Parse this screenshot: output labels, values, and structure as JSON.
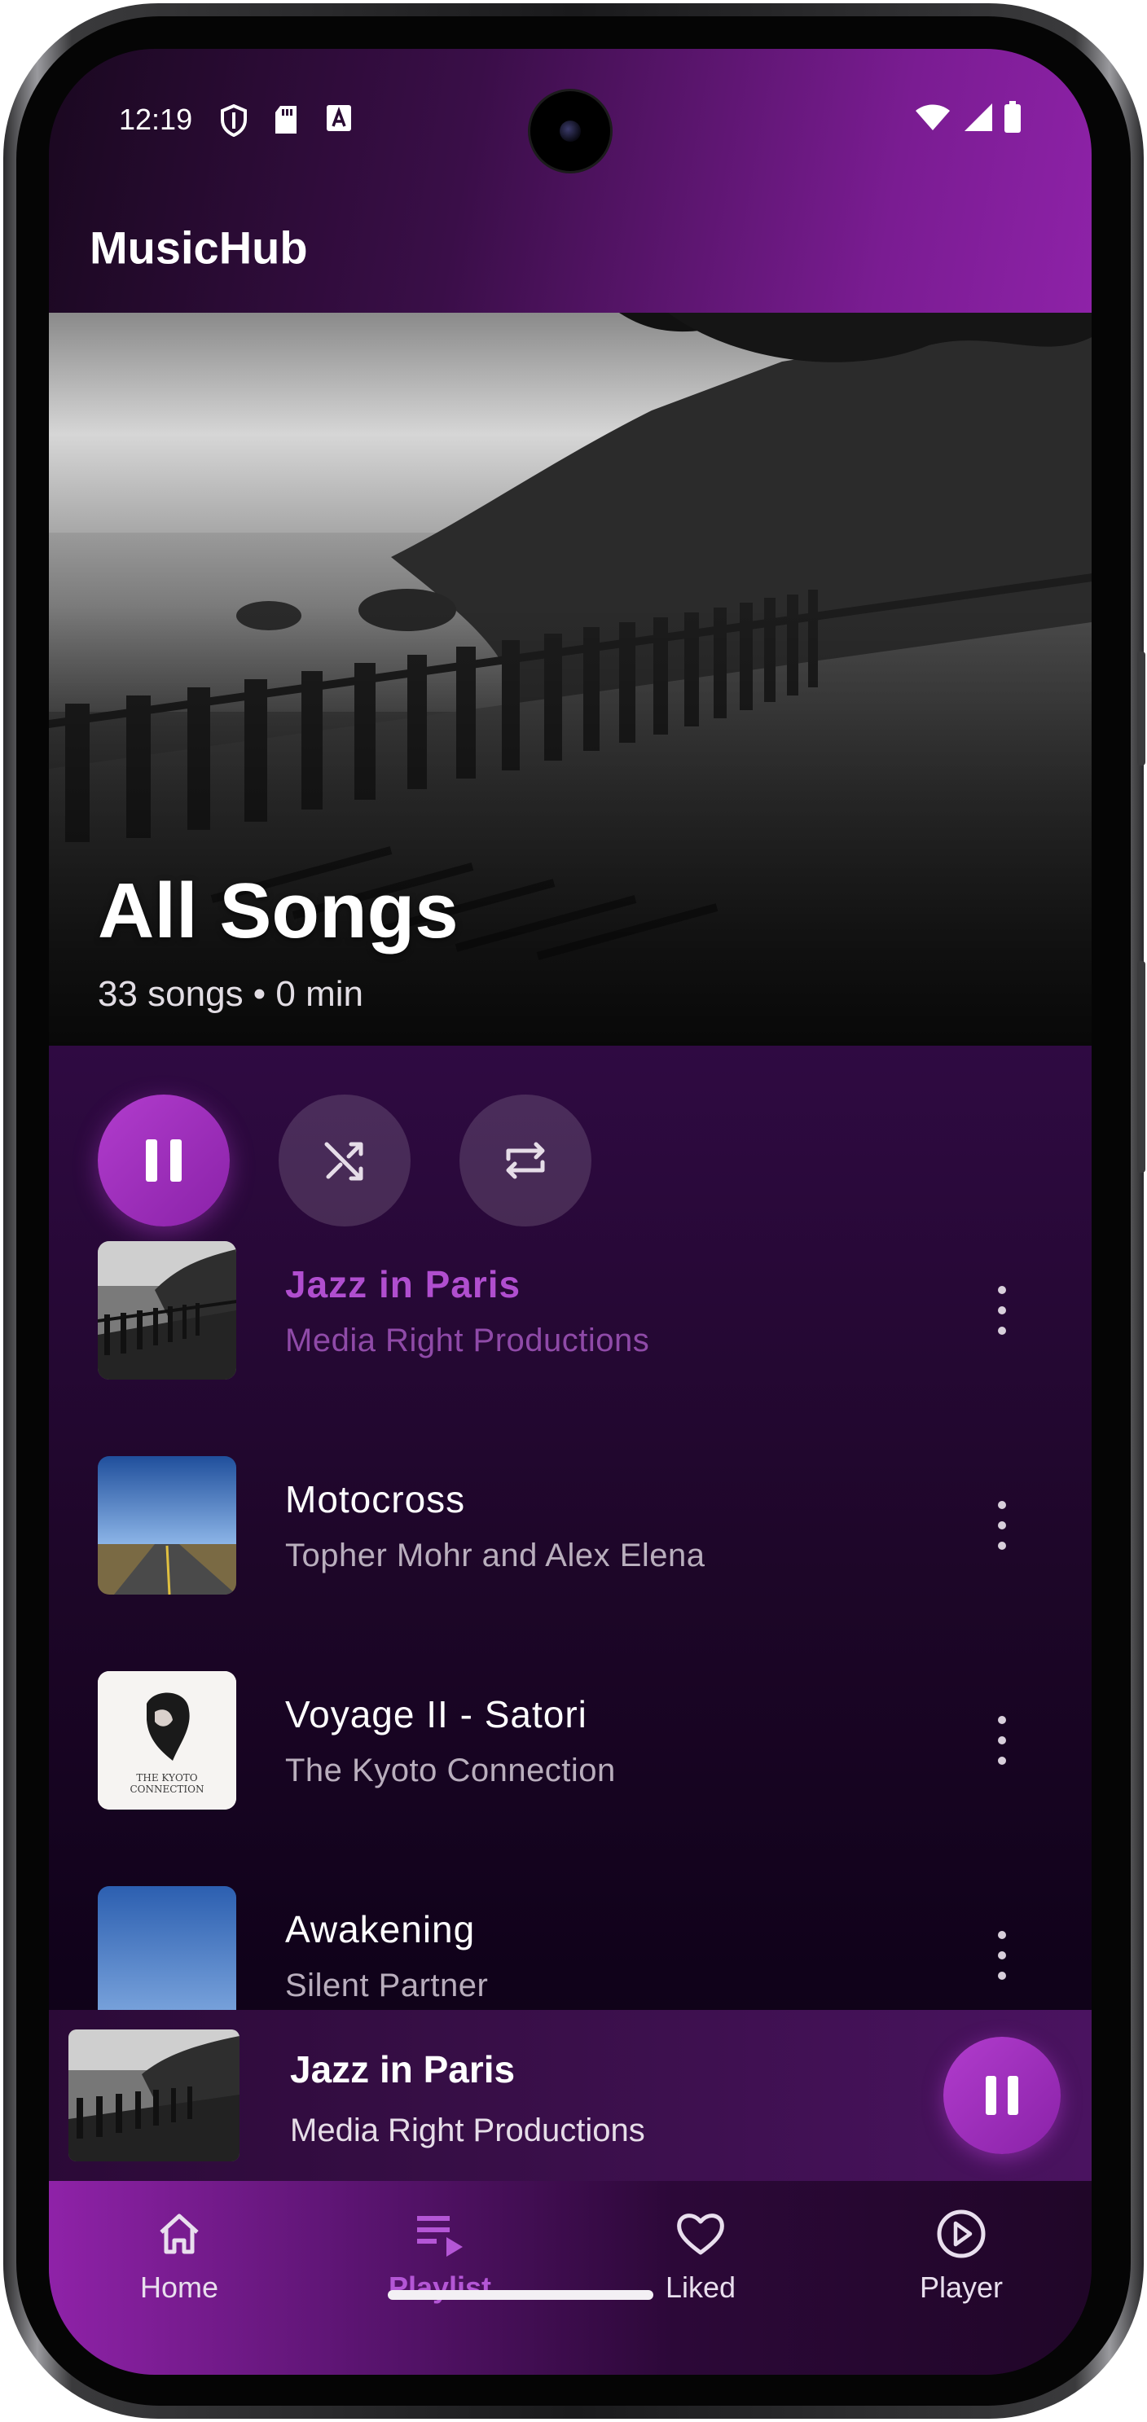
{
  "status_bar": {
    "time": "12:19"
  },
  "app": {
    "title": "MusicHub"
  },
  "playlist": {
    "title": "All Songs",
    "subtitle": "33 songs • 0 min"
  },
  "controls": {
    "play_pause": "pause-icon",
    "shuffle": "shuffle-icon",
    "repeat": "repeat-icon"
  },
  "songs": [
    {
      "title": "Jazz in Paris",
      "artist": "Media Right Productions",
      "active": true
    },
    {
      "title": "Motocross",
      "artist": "Topher Mohr and Alex Elena",
      "active": false
    },
    {
      "title": "Voyage II - Satori",
      "artist": "The Kyoto Connection",
      "active": false
    },
    {
      "title": "Awakening",
      "artist": "Silent Partner",
      "active": false
    }
  ],
  "album_art_text": "THE KYOTO CONNECTION",
  "now_playing": {
    "title": "Jazz in Paris",
    "artist": "Media Right Productions"
  },
  "nav": [
    {
      "label": "Home",
      "icon": "home-icon",
      "active": false
    },
    {
      "label": "Playlist",
      "icon": "playlist-icon",
      "active": true
    },
    {
      "label": "Liked",
      "icon": "heart-icon",
      "active": false
    },
    {
      "label": "Player",
      "icon": "play-circle-icon",
      "active": false
    }
  ],
  "colors": {
    "accent": "#b13ccd",
    "active_text": "#b04ecf"
  }
}
